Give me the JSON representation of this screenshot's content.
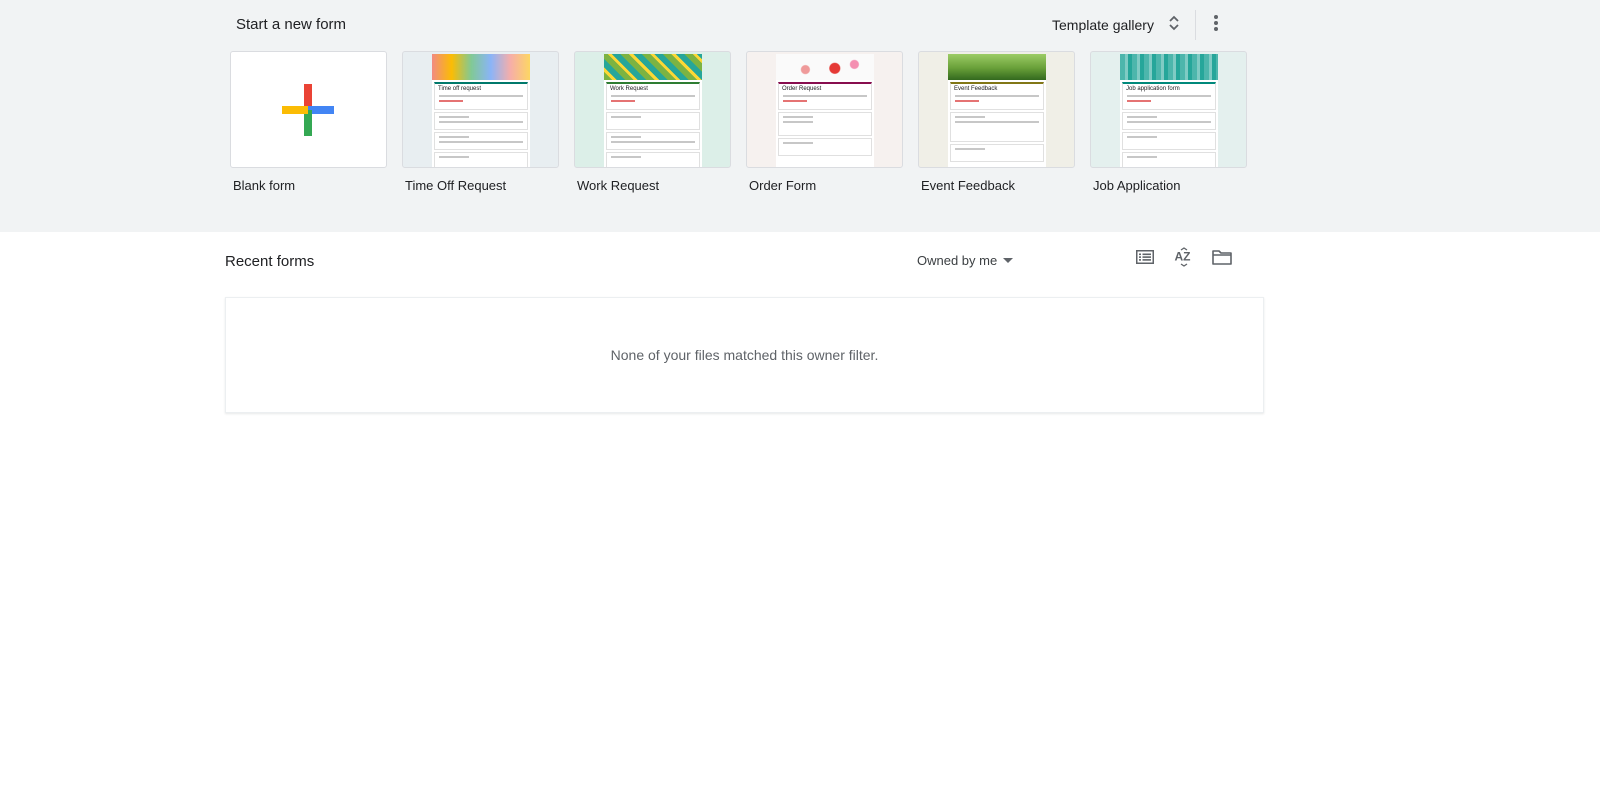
{
  "new_form": {
    "title": "Start a new form",
    "gallery_label": "Template gallery",
    "gallery_icon": "unfold-more-icon",
    "more_icon": "more-vert-icon"
  },
  "templates": [
    {
      "name": "Blank form",
      "icon": "google-plus-icon"
    },
    {
      "name": "Time Off Request",
      "preview_title": "Time off request",
      "accent": "#00796b"
    },
    {
      "name": "Work Request",
      "preview_title": "Work Request",
      "accent": "#2e7d32"
    },
    {
      "name": "Order Form",
      "preview_title": "Order Request",
      "accent": "#880e4f"
    },
    {
      "name": "Event Feedback",
      "preview_title": "Event Feedback",
      "accent": "#827717"
    },
    {
      "name": "Job Application",
      "preview_title": "Job application form",
      "accent": "#00897b"
    }
  ],
  "recent": {
    "title": "Recent forms",
    "owner_filter": "Owned by me",
    "view_icons": [
      "list-view-icon",
      "sort-az-icon",
      "folder-icon"
    ],
    "empty_message": "None of your files matched this owner filter."
  },
  "colors": {
    "band_bg": "#f1f3f4",
    "plus_red": "#ea4335",
    "plus_blue": "#4285f4",
    "plus_yellow": "#fbbc04",
    "plus_green": "#34a853"
  }
}
